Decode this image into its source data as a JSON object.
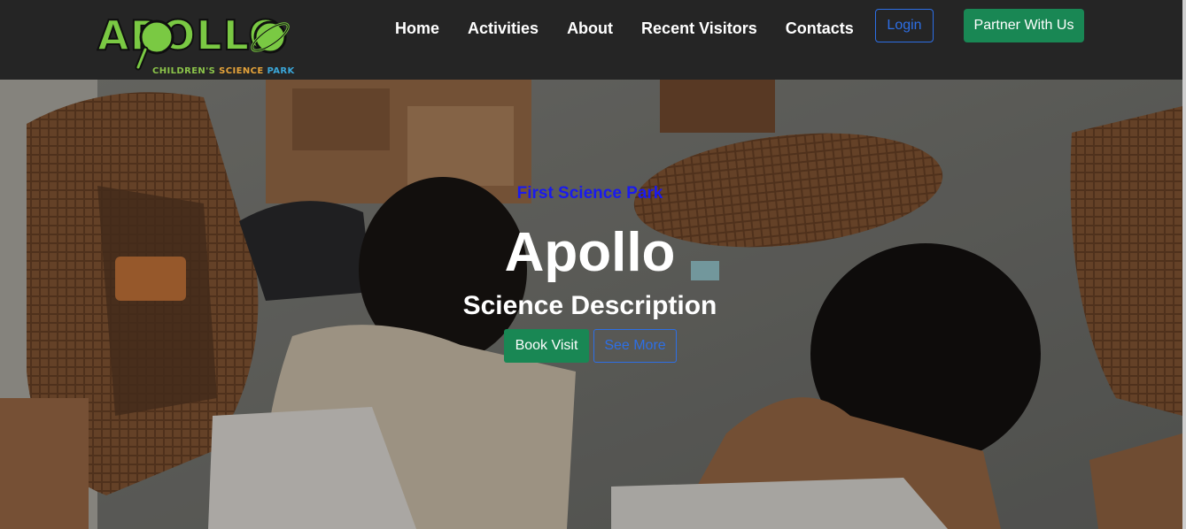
{
  "brand": {
    "logo_word": "APOLLO",
    "logo_sub_1": "CHILDREN'S",
    "logo_sub_2": "SCIENCE",
    "logo_sub_3": "PARK"
  },
  "nav": {
    "links": [
      "Home",
      "Activities",
      "About",
      "Recent Visitors",
      "Contacts"
    ],
    "login_label": "Login",
    "partner_label": "Partner With Us"
  },
  "hero": {
    "tagline": "First Science Park",
    "title": "Apollo",
    "description": "Science Description",
    "book_label": "Book Visit",
    "more_label": "See More"
  },
  "colors": {
    "navbar_bg": "#252525",
    "accent_green": "#198754",
    "accent_blue": "#2d6fe6",
    "logo_green": "#7ac943"
  }
}
